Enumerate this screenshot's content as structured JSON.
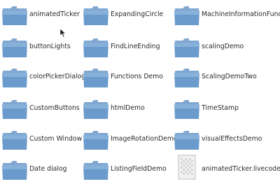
{
  "window": {
    "title": ""
  },
  "files": {
    "col1": [
      {
        "label": "animatedTicker",
        "icon": "folder-icon"
      },
      {
        "label": "buttonLights",
        "icon": "folder-icon"
      },
      {
        "label": "colorPickerDialog",
        "icon": "folder-icon"
      },
      {
        "label": "CustomButtons",
        "icon": "folder-icon"
      },
      {
        "label": "Custom Window",
        "icon": "folder-icon"
      },
      {
        "label": "Date dialog",
        "icon": "folder-icon"
      }
    ],
    "col2": [
      {
        "label": "ExpandingCircle",
        "icon": "folder-icon"
      },
      {
        "label": "FindLineEnding",
        "icon": "folder-icon"
      },
      {
        "label": "Functions Demo",
        "icon": "folder-icon"
      },
      {
        "label": "htmlDemo",
        "icon": "folder-icon"
      },
      {
        "label": "ImageRotationDemo",
        "icon": "folder-icon"
      },
      {
        "label": "ListingFieldDemo",
        "icon": "folder-icon"
      }
    ],
    "col3": [
      {
        "label": "MachineInformationFunctions",
        "icon": "folder-icon"
      },
      {
        "label": "scalingDemo",
        "icon": "folder-icon"
      },
      {
        "label": "ScalingDemoTwo",
        "icon": "folder-icon"
      },
      {
        "label": "TimeStamp",
        "icon": "folder-icon"
      },
      {
        "label": "visualEffectsDemo",
        "icon": "folder-icon"
      },
      {
        "label": "animatedTicker.livecode",
        "icon": "livecode-file-icon"
      }
    ]
  },
  "colors": {
    "folder_top": "#8fb4d8",
    "folder_bottom": "#5a8fc4",
    "text": "#2a2a2a"
  }
}
